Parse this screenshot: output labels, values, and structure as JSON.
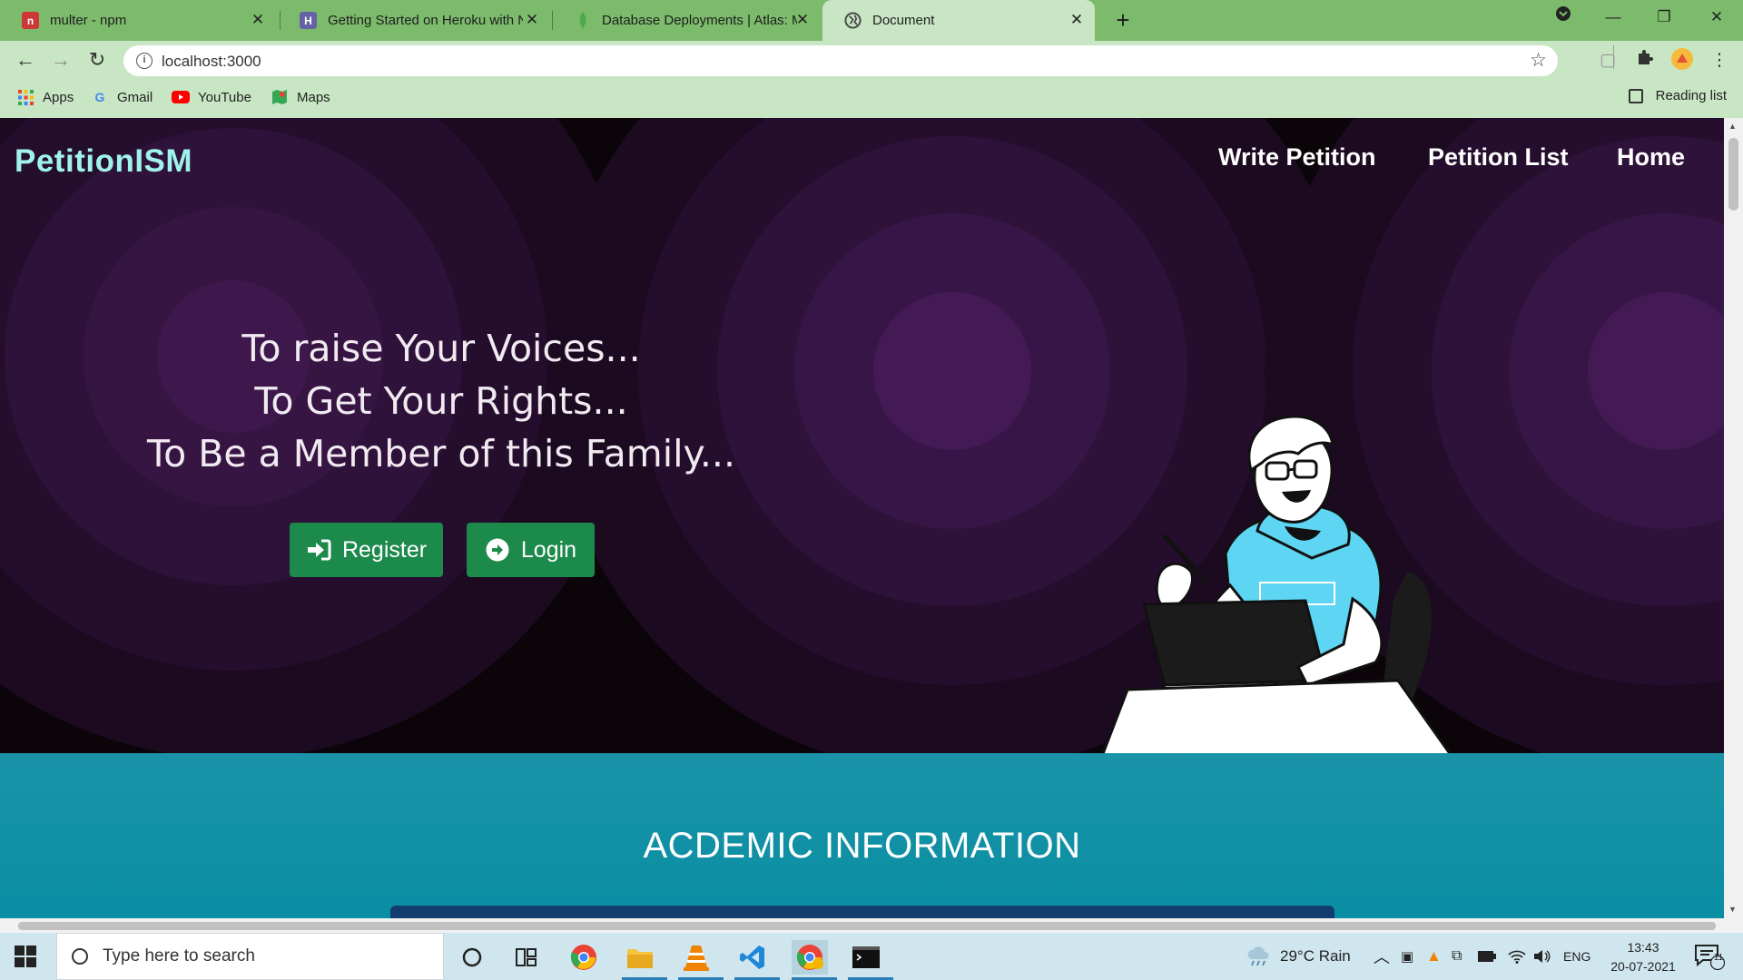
{
  "browser": {
    "tabs": [
      {
        "title": "multer - npm",
        "icon": "npm-icon",
        "color": "#cb3837"
      },
      {
        "title": "Getting Started on Heroku with N",
        "icon": "heroku-icon",
        "color": "#6762a6"
      },
      {
        "title": "Database Deployments | Atlas: M",
        "icon": "mongodb-leaf-icon",
        "color": "#4ea94b"
      },
      {
        "title": "Document",
        "icon": "globe-icon",
        "color": "#555555",
        "active": true
      }
    ],
    "url": "localhost:3000",
    "bookmarks": [
      {
        "label": "Apps",
        "icon": "apps-grid-icon"
      },
      {
        "label": "Gmail",
        "icon": "google-icon"
      },
      {
        "label": "YouTube",
        "icon": "youtube-icon"
      },
      {
        "label": "Maps",
        "icon": "maps-icon"
      }
    ],
    "reading_list": "Reading list"
  },
  "page": {
    "brand": "PetitionISM",
    "nav": [
      "Write Petition",
      "Petition List",
      "Home"
    ],
    "hero": {
      "lines": [
        "To raise Your Voices...",
        "To Get Your Rights...",
        "To Be a Member of this Family..."
      ],
      "register_label": "Register",
      "login_label": "Login"
    },
    "section_title": "ACDEMIC INFORMATION",
    "colors": {
      "hero_bg": "#0b0409",
      "ring_purple": "#3a1847",
      "brand": "#9ff3ea",
      "button": "#1b8a4a",
      "section_bg": "#1a93a8"
    }
  },
  "taskbar": {
    "search_placeholder": "Type here to search",
    "weather": "29°C  Rain",
    "language": "ENG",
    "time": "13:43",
    "date": "20-07-2021",
    "notification_count": "11"
  }
}
